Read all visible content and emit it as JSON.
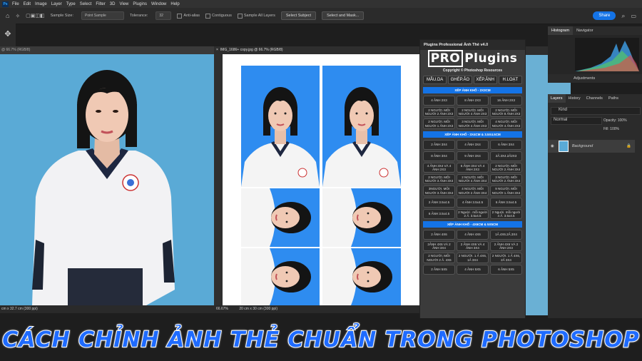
{
  "menu": {
    "app_icon": "Ps",
    "items": [
      "File",
      "Edit",
      "Image",
      "Layer",
      "Type",
      "Select",
      "Filter",
      "3D",
      "View",
      "Plugins",
      "Window",
      "Help"
    ]
  },
  "options": {
    "sample_size_label": "Sample Size:",
    "sample_size_value": "Point Sample",
    "tolerance_label": "Tolerance:",
    "tolerance_value": "32",
    "anti_alias": "Anti-alias",
    "contiguous": "Contiguous",
    "sample_all": "Sample All Layers",
    "select_subject": "Select Subject",
    "select_mask": "Select and Mask...",
    "share": "Share"
  },
  "doc1": {
    "tab": "@ 66.7% (RGB/8)",
    "status": "cm x 32.7 cm (300 ppi)"
  },
  "doc2": {
    "tab": "IMG_1686+ copy.jpg @ 66.7% (RGB/8)",
    "status_zoom": "66.67%",
    "status_size": "20 cm x 30 cm (300 ppi)"
  },
  "plugin": {
    "title": "Plugins Professional Ảnh Thẻ v4.0",
    "logo_pro": "PRO",
    "logo_plugins": "Plugins",
    "copyright": "Copyright © Photoshop Resources",
    "tabs": [
      "MẪU.DA",
      "GHÉP.ẢO",
      "XẾP.ẢNH",
      "H.LOẠT"
    ],
    "sections": [
      {
        "title": "XẾP ẢNH KHỔ - 2X3CM",
        "buttons": [
          "4 ẢNH 2X3",
          "8 ẢNH 2X3",
          "16 ẢNH 2X3",
          "2 NGƯỜI. MỖI NGƯỜI 2 ẢNH 2X3",
          "2 NGƯỜI. MỖI NGƯỜI 4 ẢNH 2X3",
          "2 NGƯỜI. MỖI NGƯỜI 8 ẢNH 2X3",
          "2 NGƯỜI. MỖI NGƯỜI 1 ẢNH 2X3",
          "3 NGƯỜI. MỖI NGƯỜI 4 ẢNH 2X3",
          "4 NGƯỜI. MỖI NGƯỜI 4 ẢNH 2X3"
        ]
      },
      {
        "title": "XẾP ẢNH KHỔ - 3X4CM & 3.5X4.5CM",
        "buttons": [
          "2 ẢNH 3X4",
          "4 ẢNH 3X4",
          "6 ẢNH 3X4",
          "8 ẢNH 3X4",
          "9 ẢNH 3X4",
          "2Ả.3X4.2Ả2X3",
          "4 ẢNH 3X4 VÀ 4 ẢNH 2X3",
          "6 ẢNH 3X4 VÀ 4 ẢNH 2X3",
          "2 NGƯỜI. MỖI NGƯỜI 2 ẢNH 3X4",
          "2 NGƯỜI. MỖI NGƯỜI 3 ẢNH 3X4",
          "2 NGƯỜI. MỖI NGƯỜI 4 ẢNH 3X4",
          "3 NGƯỜI. MỖI NGƯỜI 2 ẢNH 3X4",
          "3NGƯỜI. MỖI NGƯỜI 3 ẢNH 3X4",
          "4 NGƯỜI. MỖI NGƯỜI 2 ẢNH 3X4",
          "9 NGƯỜI. MỖI NGƯỜI 1 ẢNH 3X4",
          "2 ẢNH 3.5x4.5",
          "4 ẢNH 3.5x4.5",
          "6 ẢNH 3.5x4.5",
          "6 ẢNH 3.5x4.5",
          "2 Người . mỗi người 2 Ả. 3.5x4.5",
          "2 Người. mỗi người 4 Ả. 3.5x4.5"
        ]
      },
      {
        "title": "XẾP ẢNH KHỔ - 4X6CM & 5X5CM",
        "buttons": [
          "2 ẢNH 4X6",
          "4 ẢNH 4X6",
          "1Ả.4X6.2Ả.3X4",
          "2ẢNH 4X6 VÀ 2 ẢNH 3X4",
          "2 ẢNH 4X6 VÀ 4 ẢNH 3X4",
          "2 ẢNH 4X6 VÀ 2 ẢNH 2X3",
          "2 NGƯỜI. MỖI NGƯỜI 2 Ả. 4X6",
          "2 NGƯỜI. 1 Ả 4X6, 1Ả 3X4",
          "2 NGƯỜI. 1 Ả 4X6, 2Ả 3X4",
          "2 ẢNH 5X5",
          "4 ẢNH 5X5",
          "6 ẢNH 5X5"
        ]
      }
    ]
  },
  "panels": {
    "histogram_tabs": [
      "Histogram",
      "Navigator"
    ],
    "adjust_tab": "Adjustments",
    "layer_tabs": [
      "Layers",
      "History",
      "Channels",
      "Paths"
    ],
    "kind": "Kind",
    "blend": "Normal",
    "opacity": "Opacity: 100%",
    "fill": "Fill: 100%",
    "background_layer": "Background"
  },
  "banner": "CÁCH CHỈNH ẢNH THẺ CHUẨN TRONG PHOTOSHOP"
}
